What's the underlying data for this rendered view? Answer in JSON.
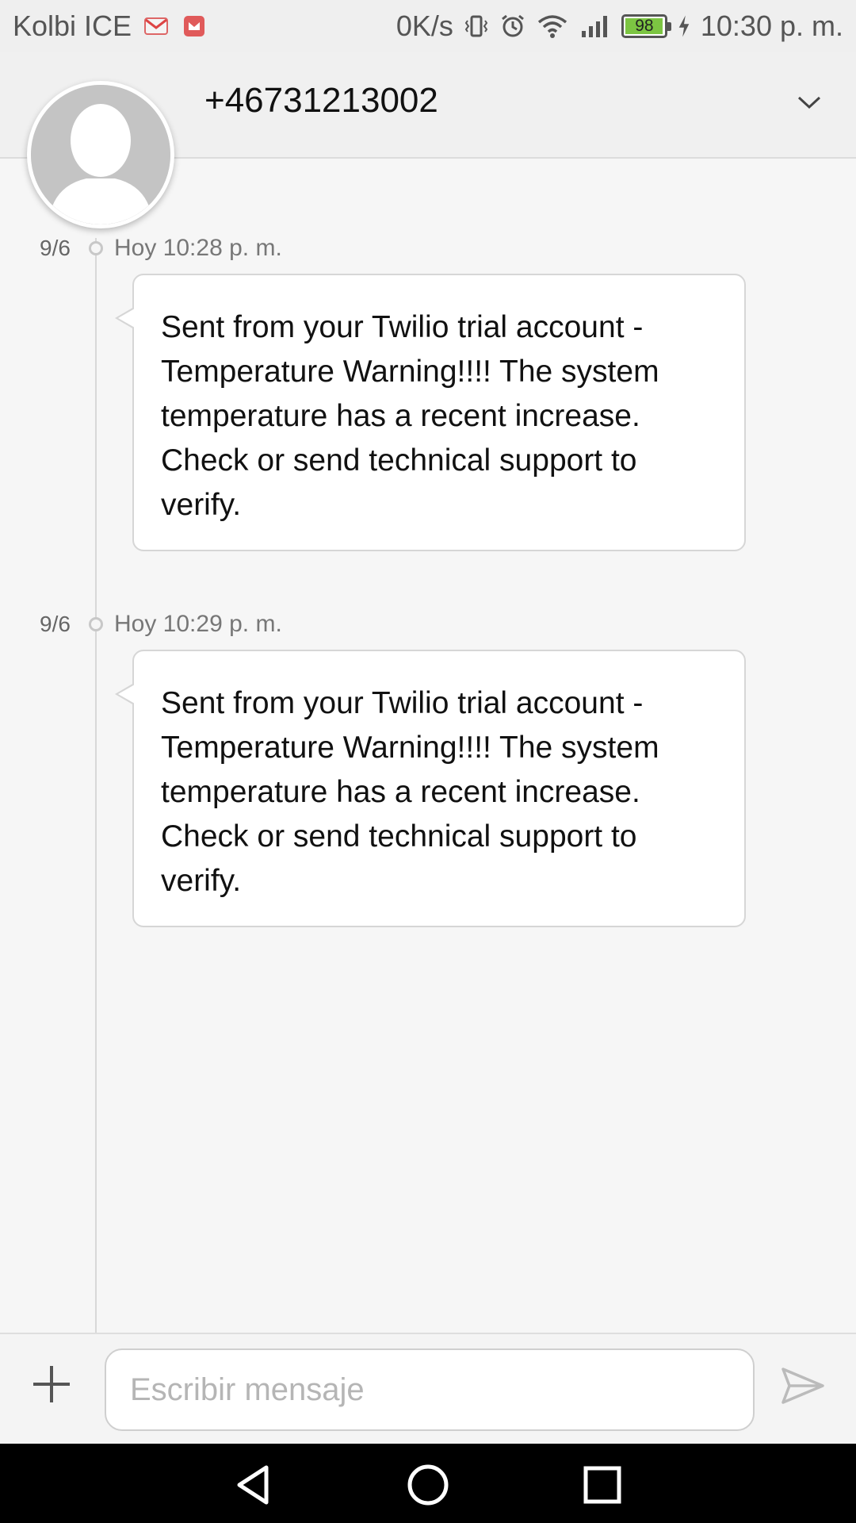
{
  "status_bar": {
    "carrier": "Kolbi ICE",
    "net_speed": "0K/s",
    "battery_level": "98",
    "time": "10:30 p. m.",
    "icons": [
      "gmail-icon",
      "notification-app-icon",
      "vibrate-icon",
      "alarm-icon",
      "wifi-icon",
      "signal-icon",
      "battery-icon",
      "charging-icon"
    ]
  },
  "header": {
    "contact_number": "+46731213002",
    "expand_icon": "chevron-down-icon"
  },
  "messages": [
    {
      "date": "9/6",
      "time": "Hoy 10:28 p. m.",
      "text": "Sent from your Twilio trial account - Temperature Warning!!!! The system temperature has a recent increase. Check or send technical support to verify."
    },
    {
      "date": "9/6",
      "time": "Hoy 10:29 p. m.",
      "text": "Sent from your Twilio trial account - Temperature Warning!!!! The system temperature has a recent increase. Check or send technical support to verify."
    }
  ],
  "composer": {
    "placeholder": "Escribir mensaje",
    "add_icon": "plus-icon",
    "send_icon": "send-icon"
  },
  "navigation": {
    "buttons": [
      "back-icon",
      "home-icon",
      "recents-icon"
    ]
  },
  "colors": {
    "battery_fill": "#7cc542",
    "background": "#f6f6f6",
    "bubble": "#ffffff"
  }
}
